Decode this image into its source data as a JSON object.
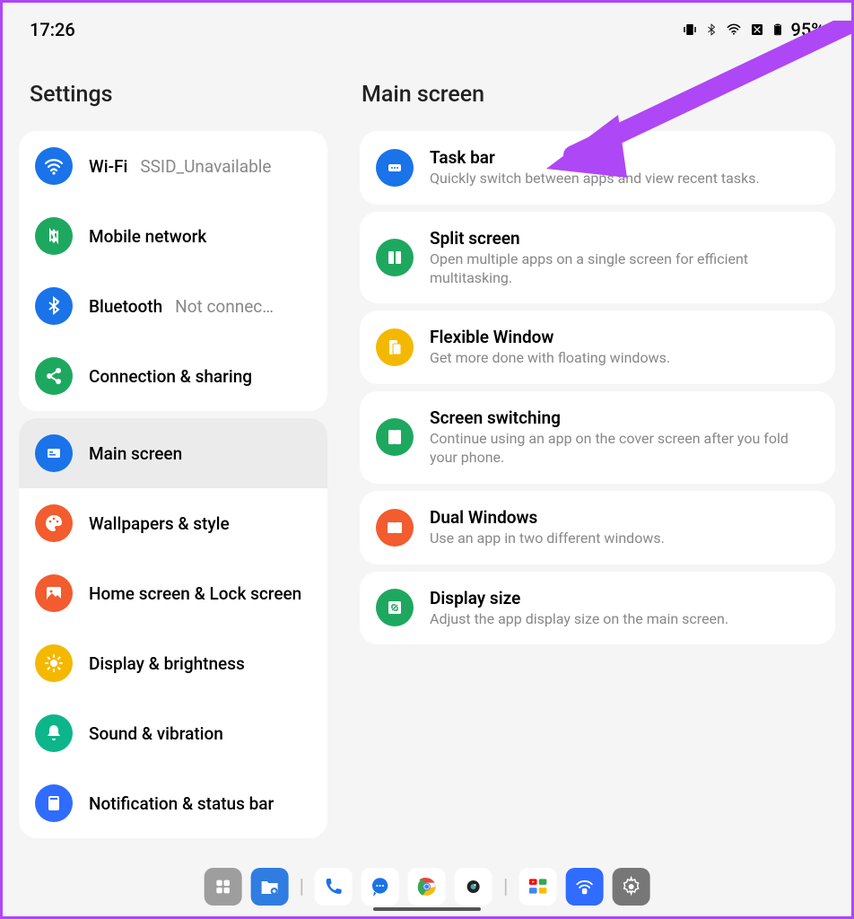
{
  "status": {
    "time": "17:26",
    "battery": "95%"
  },
  "sidebar": {
    "title": "Settings",
    "groups": [
      {
        "items": [
          {
            "id": "wifi",
            "label": "Wi-Fi",
            "sub": "SSID_Unavailable",
            "icon": "wifi",
            "color": "bg-blue"
          },
          {
            "id": "mobile",
            "label": "Mobile network",
            "sub": "",
            "icon": "mobile",
            "color": "bg-green"
          },
          {
            "id": "bt",
            "label": "Bluetooth",
            "sub": "Not connec…",
            "icon": "bt",
            "color": "bg-blue"
          },
          {
            "id": "conn",
            "label": "Connection & sharing",
            "sub": "",
            "icon": "share",
            "color": "bg-green"
          }
        ]
      },
      {
        "items": [
          {
            "id": "mainscreen",
            "label": "Main screen",
            "sub": "",
            "icon": "mainscreen",
            "color": "bg-blue",
            "selected": true
          },
          {
            "id": "wallpapers",
            "label": "Wallpapers & style",
            "sub": "",
            "icon": "palette",
            "color": "bg-orange"
          },
          {
            "id": "homelock",
            "label": "Home screen & Lock screen",
            "sub": "",
            "icon": "image",
            "color": "bg-orange"
          },
          {
            "id": "display",
            "label": "Display & brightness",
            "sub": "",
            "icon": "sun",
            "color": "bg-yellow"
          },
          {
            "id": "sound",
            "label": "Sound & vibration",
            "sub": "",
            "icon": "bell",
            "color": "bg-teal"
          },
          {
            "id": "notif",
            "label": "Notification & status bar",
            "sub": "",
            "icon": "notif",
            "color": "bg-blue2"
          }
        ]
      }
    ]
  },
  "main": {
    "title": "Main screen",
    "items": [
      {
        "id": "taskbar",
        "title": "Task bar",
        "desc": "Quickly switch between apps and view recent tasks.",
        "icon": "taskbar",
        "color": "bg-blue"
      },
      {
        "id": "split",
        "title": "Split screen",
        "desc": "Open multiple apps on a single screen for efficient multitasking.",
        "icon": "split",
        "color": "bg-green"
      },
      {
        "id": "flex",
        "title": "Flexible Window",
        "desc": "Get more done with floating windows.",
        "icon": "flex",
        "color": "bg-yellow"
      },
      {
        "id": "switch",
        "title": "Screen switching",
        "desc": "Continue using an app on the cover screen after you fold your phone.",
        "icon": "switch",
        "color": "bg-green"
      },
      {
        "id": "dual",
        "title": "Dual Windows",
        "desc": "Use an app in two different windows.",
        "icon": "dual",
        "color": "bg-orange"
      },
      {
        "id": "dispsize",
        "title": "Display size",
        "desc": "Adjust the app display size on the main screen.",
        "icon": "dispsize",
        "color": "bg-green"
      }
    ]
  },
  "taskbar": {
    "apps": [
      "apps",
      "files",
      "|",
      "phone",
      "messages",
      "chrome",
      "camera",
      "|",
      "youtube",
      "remote",
      "settings"
    ]
  }
}
